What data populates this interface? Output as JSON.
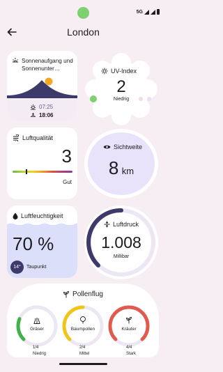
{
  "status": {
    "network": "5G"
  },
  "header": {
    "title": "London"
  },
  "sun": {
    "title": "Sonnenaufgang und Sonnenunter…",
    "sunrise": "07:25",
    "sunset": "18:06"
  },
  "uv": {
    "label": "UV-Index",
    "value": "2",
    "level": "Niedrig",
    "accent": "#7dd16f"
  },
  "air": {
    "label": "Luftqualität",
    "value": "3",
    "level": "Gut",
    "level_fraction": 0.22
  },
  "visibility": {
    "label": "Sichtweite",
    "value": "8",
    "unit": "km"
  },
  "humidity": {
    "label": "Luftfeuchtigkeit",
    "value": "70 %",
    "dewpoint": "14°",
    "dewpoint_label": "Taupunkt"
  },
  "pressure": {
    "label": "Luftdruck",
    "value": "1.008",
    "unit": "Millibar"
  },
  "pollen": {
    "title": "Pollenflug",
    "items": [
      {
        "name": "Gräser",
        "count": "1/4",
        "level": "Niedrig",
        "color": "#3fb24a",
        "fraction": 0.25
      },
      {
        "name": "Baumpollen",
        "count": "2/4",
        "level": "Mittel",
        "color": "#f0c419",
        "fraction": 0.5
      },
      {
        "name": "Kräuter",
        "count": "4/4",
        "level": "Stark",
        "color": "#e05a4e",
        "fraction": 1.0
      }
    ]
  }
}
